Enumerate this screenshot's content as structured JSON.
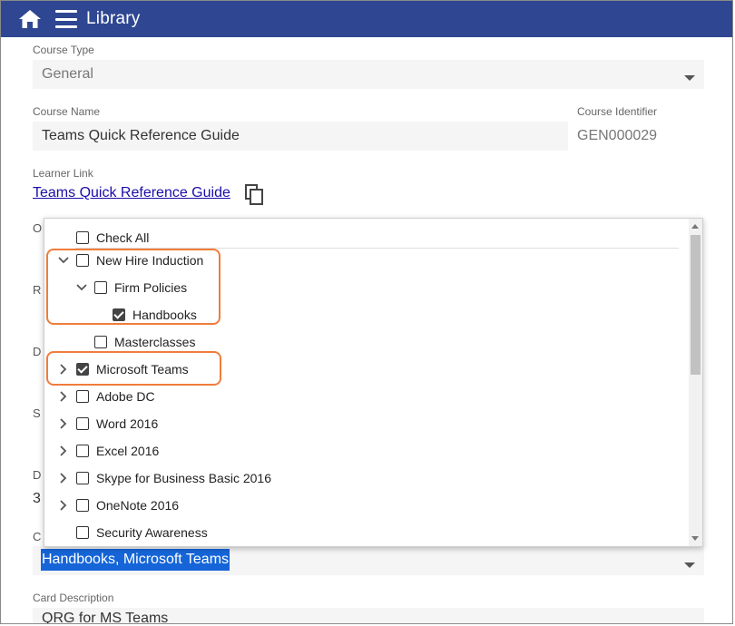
{
  "app": {
    "title": "Library"
  },
  "course_type": {
    "label": "Course Type",
    "value": "General"
  },
  "course_name": {
    "label": "Course Name",
    "value": "Teams Quick Reference Guide"
  },
  "course_identifier": {
    "label": "Course Identifier",
    "value": "GEN000029"
  },
  "learner_link": {
    "label": "Learner Link",
    "link_text": "Teams Quick Reference Guide"
  },
  "partial_labels": [
    "O",
    "R",
    "D",
    "S",
    "D",
    "3",
    "C"
  ],
  "dropdown": {
    "check_all": "Check All",
    "items": [
      {
        "label": "New Hire Induction",
        "checked": false,
        "expanded": true
      },
      {
        "label": "Firm Policies",
        "checked": false,
        "expanded": true
      },
      {
        "label": "Handbooks",
        "checked": true
      },
      {
        "label": "Masterclasses",
        "checked": false
      },
      {
        "label": "Microsoft Teams",
        "checked": true,
        "expanded": false
      },
      {
        "label": "Adobe DC",
        "checked": false,
        "expanded": false
      },
      {
        "label": "Word 2016",
        "checked": false,
        "expanded": false
      },
      {
        "label": "Excel 2016",
        "checked": false,
        "expanded": false
      },
      {
        "label": "Skype for Business Basic 2016",
        "checked": false,
        "expanded": false
      },
      {
        "label": "OneNote 2016",
        "checked": false,
        "expanded": false
      },
      {
        "label": "Security Awareness",
        "checked": false
      }
    ]
  },
  "categories_value": "Handbooks, Microsoft Teams",
  "card_description": {
    "label": "Card Description",
    "value": "QRG for MS Teams"
  },
  "colors": {
    "header": "#2f4792",
    "highlight": "#f07c3c",
    "selection": "#1565d8"
  }
}
